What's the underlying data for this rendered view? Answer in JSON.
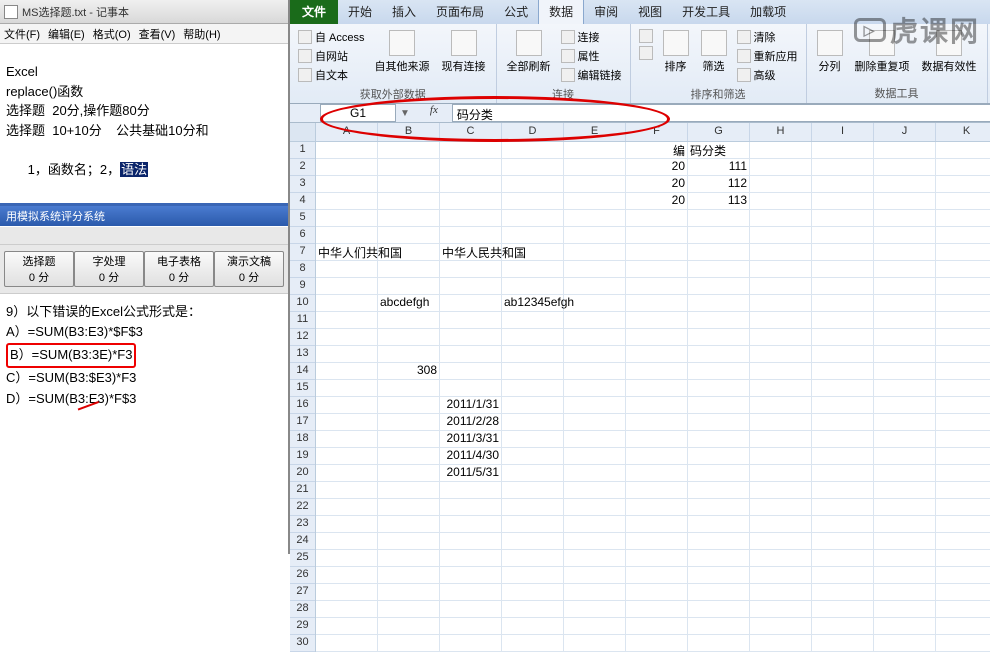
{
  "notepad": {
    "title": "MS选择题.txt - 记事本",
    "menus": [
      "文件(F)",
      "编辑(E)",
      "格式(O)",
      "查看(V)",
      "帮助(H)"
    ],
    "lines": {
      "l1": "Excel",
      "l2": "replace()函数",
      "l3": "",
      "l4": "选择题  20分,操作题80分",
      "l5": "选择题  10+10分    公共基础10分和",
      "l6": "",
      "l7_pre": "1，函数名；2，",
      "l7_hl": "语法"
    }
  },
  "exam": {
    "bar_title": "用模拟系统评分系统",
    "scores": [
      {
        "t1": "选择题",
        "t2": "0 分"
      },
      {
        "t1": "字处理",
        "t2": "0 分"
      },
      {
        "t1": "电子表格",
        "t2": "0 分"
      },
      {
        "t1": "演示文稿",
        "t2": "0 分"
      }
    ],
    "question": "9）以下错误的Excel公式形式是：",
    "opts": {
      "a": "A）=SUM(B3:E3)*$F$3",
      "b": "B）=SUM(B3:3E)*F3",
      "c": "C）=SUM(B3:$E3)*F3",
      "d": "D）=SUM(B3:E3)*F$3"
    }
  },
  "excel": {
    "tabs": [
      "开始",
      "插入",
      "页面布局",
      "公式",
      "数据",
      "审阅",
      "视图",
      "开发工具",
      "加载项"
    ],
    "file_tab": "文件",
    "ribbon": {
      "access": "自 Access",
      "web": "自网站",
      "text": "自文本",
      "other": "自其他来源",
      "existing": "现有连接",
      "refresh": "全部刷新",
      "connections": "连接",
      "properties": "属性",
      "editlinks": "编辑链接",
      "sort": "排序",
      "filter": "筛选",
      "az": "A↓Z",
      "za": "Z↓A",
      "clear": "清除",
      "reapply": "重新应用",
      "advanced": "高级",
      "ttc": "分列",
      "remdup": "删除重复项",
      "valid": "数据有效性",
      "g1": "获取外部数据",
      "g2": "连接",
      "g3": "排序和筛选",
      "g4": "数据工具"
    },
    "namebox": "G1",
    "formula": "码分类",
    "columns": [
      "A",
      "B",
      "C",
      "D",
      "E",
      "F",
      "G",
      "H",
      "I",
      "J",
      "K"
    ],
    "rows_count": 30,
    "data": {
      "r1": {
        "F": "编",
        "G": "码分类"
      },
      "r2": {
        "F": "20",
        "G": "111"
      },
      "r3": {
        "F": "20",
        "G": "112"
      },
      "r4": {
        "F": "20",
        "G": "113"
      },
      "r7": {
        "A": "中华人们共和国",
        "C": "中华人民共和国"
      },
      "r10": {
        "B": "abcdefgh",
        "D": "ab12345efgh"
      },
      "r14": {
        "B": "308"
      },
      "r16": {
        "C": "2011/1/31"
      },
      "r17": {
        "C": "2011/2/28"
      },
      "r18": {
        "C": "2011/3/31"
      },
      "r19": {
        "C": "2011/4/30"
      },
      "r20": {
        "C": "2011/5/31"
      }
    }
  },
  "watermark": "虎课网"
}
